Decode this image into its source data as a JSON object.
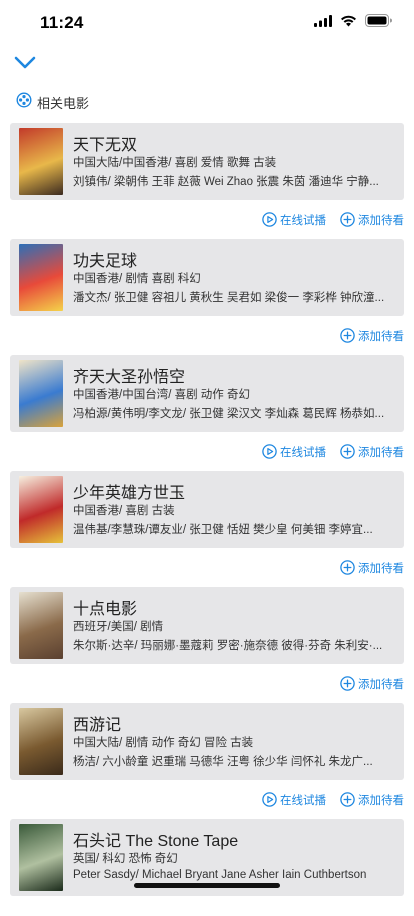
{
  "status": {
    "time": "11:24"
  },
  "section": {
    "title": "相关电影"
  },
  "movies": [
    {
      "title": "天下无双",
      "meta": "中国大陆/中国香港/ 喜剧 爱情 歌舞 古装",
      "cast": "刘镇伟/ 梁朝伟 王菲 赵薇 Wei Zhao 张震 朱茵 潘迪华 宁静...",
      "actions": [
        "在线试播",
        "添加待看"
      ],
      "poster_colors": [
        "#c23a2a",
        "#e8b84a",
        "#3b2a20"
      ]
    },
    {
      "title": "功夫足球",
      "meta": "中国香港/ 剧情 喜剧 科幻",
      "cast": "潘文杰/ 张卫健 容祖儿 黄秋生 吴君如 梁俊一 李彩桦 钟欣潼...",
      "actions": [
        "添加待看"
      ],
      "poster_colors": [
        "#2c6fb8",
        "#e84a3a",
        "#f4d34a"
      ]
    },
    {
      "title": "齐天大圣孙悟空",
      "meta": "中国香港/中国台湾/ 喜剧 动作 奇幻",
      "cast": "冯柏源/黄伟明/李文龙/ 张卫健 梁汉文 李灿森 葛民辉 杨恭如...",
      "actions": [
        "在线试播",
        "添加待看"
      ],
      "poster_colors": [
        "#f0e4c8",
        "#3a7bd0",
        "#d9a23a"
      ]
    },
    {
      "title": "少年英雄方世玉",
      "meta": "中国香港/ 喜剧 古装",
      "cast": "温伟基/李慧珠/谭友业/ 张卫健 恬妞 樊少皇 何美钿 李婷宜...",
      "actions": [
        "添加待看"
      ],
      "poster_colors": [
        "#f6f0e0",
        "#c02a2a",
        "#e6c23a"
      ]
    },
    {
      "title": "十点电影",
      "meta": "西班牙/美国/ 剧情",
      "cast": "朱尔斯·达辛/ 玛丽娜·墨蔻莉 罗密·施奈德 彼得·芬奇 朱利安·...",
      "actions": [
        "添加待看"
      ],
      "poster_colors": [
        "#e6e0d0",
        "#8a6a4a",
        "#5a4030"
      ]
    },
    {
      "title": "西游记",
      "meta": "中国大陆/ 剧情 动作 奇幻 冒险 古装",
      "cast": "杨洁/ 六小龄童 迟重瑞 马德华 汪粤 徐少华 闫怀礼 朱龙广...",
      "actions": [
        "在线试播",
        "添加待看"
      ],
      "poster_colors": [
        "#d8c8a0",
        "#7a5a30",
        "#3a2a1a"
      ]
    },
    {
      "title": "石头记 The Stone Tape",
      "meta": "英国/ 科幻 恐怖 奇幻",
      "cast": "Peter Sasdy/ Michael Bryant Jane Asher Iain Cuthbertson",
      "actions": [],
      "poster_colors": [
        "#3a5a3a",
        "#b0c0a0",
        "#1a2a1a"
      ]
    }
  ],
  "colors": {
    "accent": "#1e87e0",
    "card": "#e6e6e8"
  },
  "icons": {
    "play": "play-circle-icon",
    "add": "plus-circle-icon",
    "collapse": "chevron-down-icon",
    "section": "film-reel-icon"
  }
}
